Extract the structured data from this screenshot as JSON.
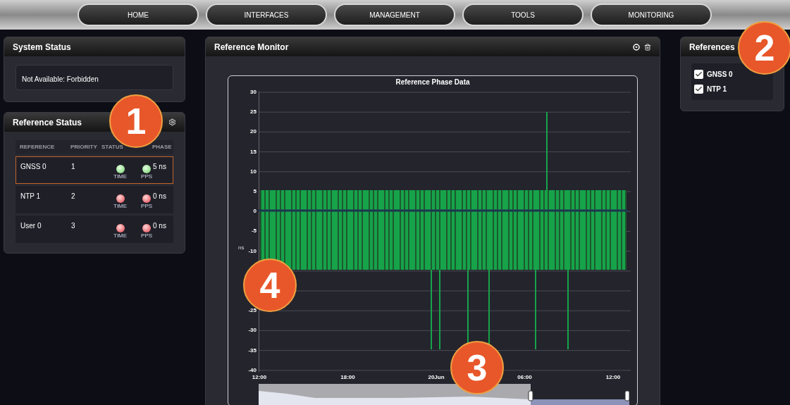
{
  "nav": [
    {
      "label": "HOME"
    },
    {
      "label": "INTERFACES"
    },
    {
      "label": "MANAGEMENT"
    },
    {
      "label": "TOOLS"
    },
    {
      "label": "MONITORING"
    }
  ],
  "system_status": {
    "title": "System Status",
    "message": "Not Available: Forbidden"
  },
  "reference_status": {
    "title": "Reference Status",
    "columns": [
      "REFERENCE",
      "PRIORITY",
      "STATUS",
      "PHASE"
    ],
    "rows": [
      {
        "reference": "GNSS 0",
        "priority": "1",
        "time_ok": true,
        "time_label": "TIME",
        "pps_ok": true,
        "pps_label": "PPS",
        "phase": "5 ns",
        "selected": true
      },
      {
        "reference": "NTP 1",
        "priority": "2",
        "time_ok": false,
        "time_label": "TIME",
        "pps_ok": false,
        "pps_label": "PPS",
        "phase": "0 ns",
        "selected": false
      },
      {
        "reference": "User 0",
        "priority": "3",
        "time_ok": false,
        "time_label": "TIME",
        "pps_ok": false,
        "pps_label": "PPS",
        "phase": "0 ns",
        "selected": false
      }
    ]
  },
  "reference_monitor": {
    "title": "Reference Monitor",
    "chart": {
      "title": "Reference Phase Data",
      "ylabel": "ns",
      "y_ticks_upper": [
        "30",
        "25",
        "20",
        "15",
        "10",
        "5",
        "0",
        "-5",
        "-10"
      ],
      "y_ticks_lower": [
        "-25",
        "-30",
        "-35",
        "-40"
      ],
      "x_ticks": [
        "12:00",
        "18:00",
        "20Jun",
        "06:00",
        "12:00"
      ]
    }
  },
  "references": {
    "title": "References",
    "items": [
      {
        "label": "GNSS 0",
        "checked": true
      },
      {
        "label": "NTP 1",
        "checked": true
      }
    ]
  },
  "callouts": [
    "1",
    "2",
    "3",
    "4"
  ]
}
